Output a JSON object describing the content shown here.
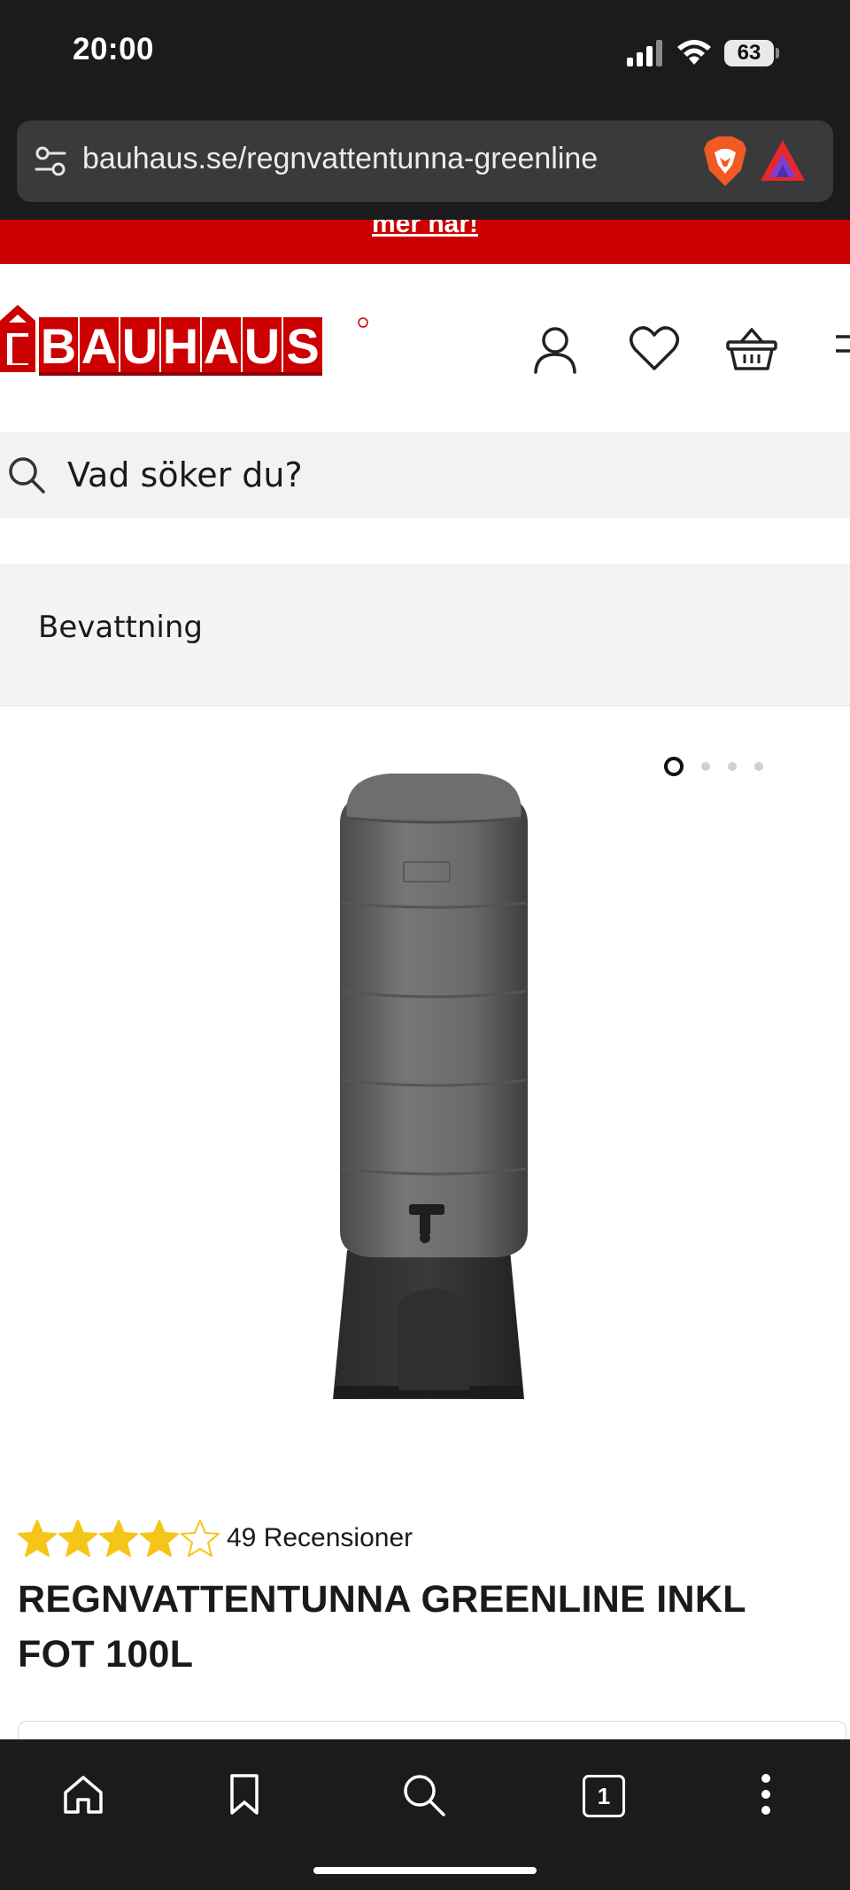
{
  "status_bar": {
    "time": "20:00",
    "battery": "63",
    "icons": [
      "cellular-signal-icon",
      "wifi-icon",
      "battery-icon"
    ]
  },
  "browser": {
    "url": "bauhaus.se/regnvattentunna-greenline",
    "icons": [
      "site-settings-icon",
      "brave-shields-icon",
      "brave-rewards-icon"
    ]
  },
  "promo": {
    "text": "mer här!"
  },
  "header": {
    "logo_text": "BAUHAUS",
    "icons": [
      "account-icon",
      "wishlist-heart-icon",
      "cart-basket-icon",
      "menu-icon"
    ]
  },
  "search": {
    "placeholder": "Vad söker du?"
  },
  "breadcrumb": {
    "label": "Bevattning"
  },
  "gallery": {
    "image_count": 4,
    "active_index": 0
  },
  "product": {
    "rating": 4,
    "rating_max": 5,
    "review_count": "49 Recensioner",
    "title": "REGNVATTENTUNNA GREENLINE INKL FOT 100L"
  },
  "toolbar": {
    "tab_count": "1",
    "icons": [
      "home-icon",
      "bookmark-icon",
      "search-icon",
      "tabs-icon",
      "more-icon"
    ]
  },
  "colors": {
    "brand_red": "#cc0000",
    "star_yellow": "#f5c518",
    "browser_chrome": "#1b1b1d"
  }
}
